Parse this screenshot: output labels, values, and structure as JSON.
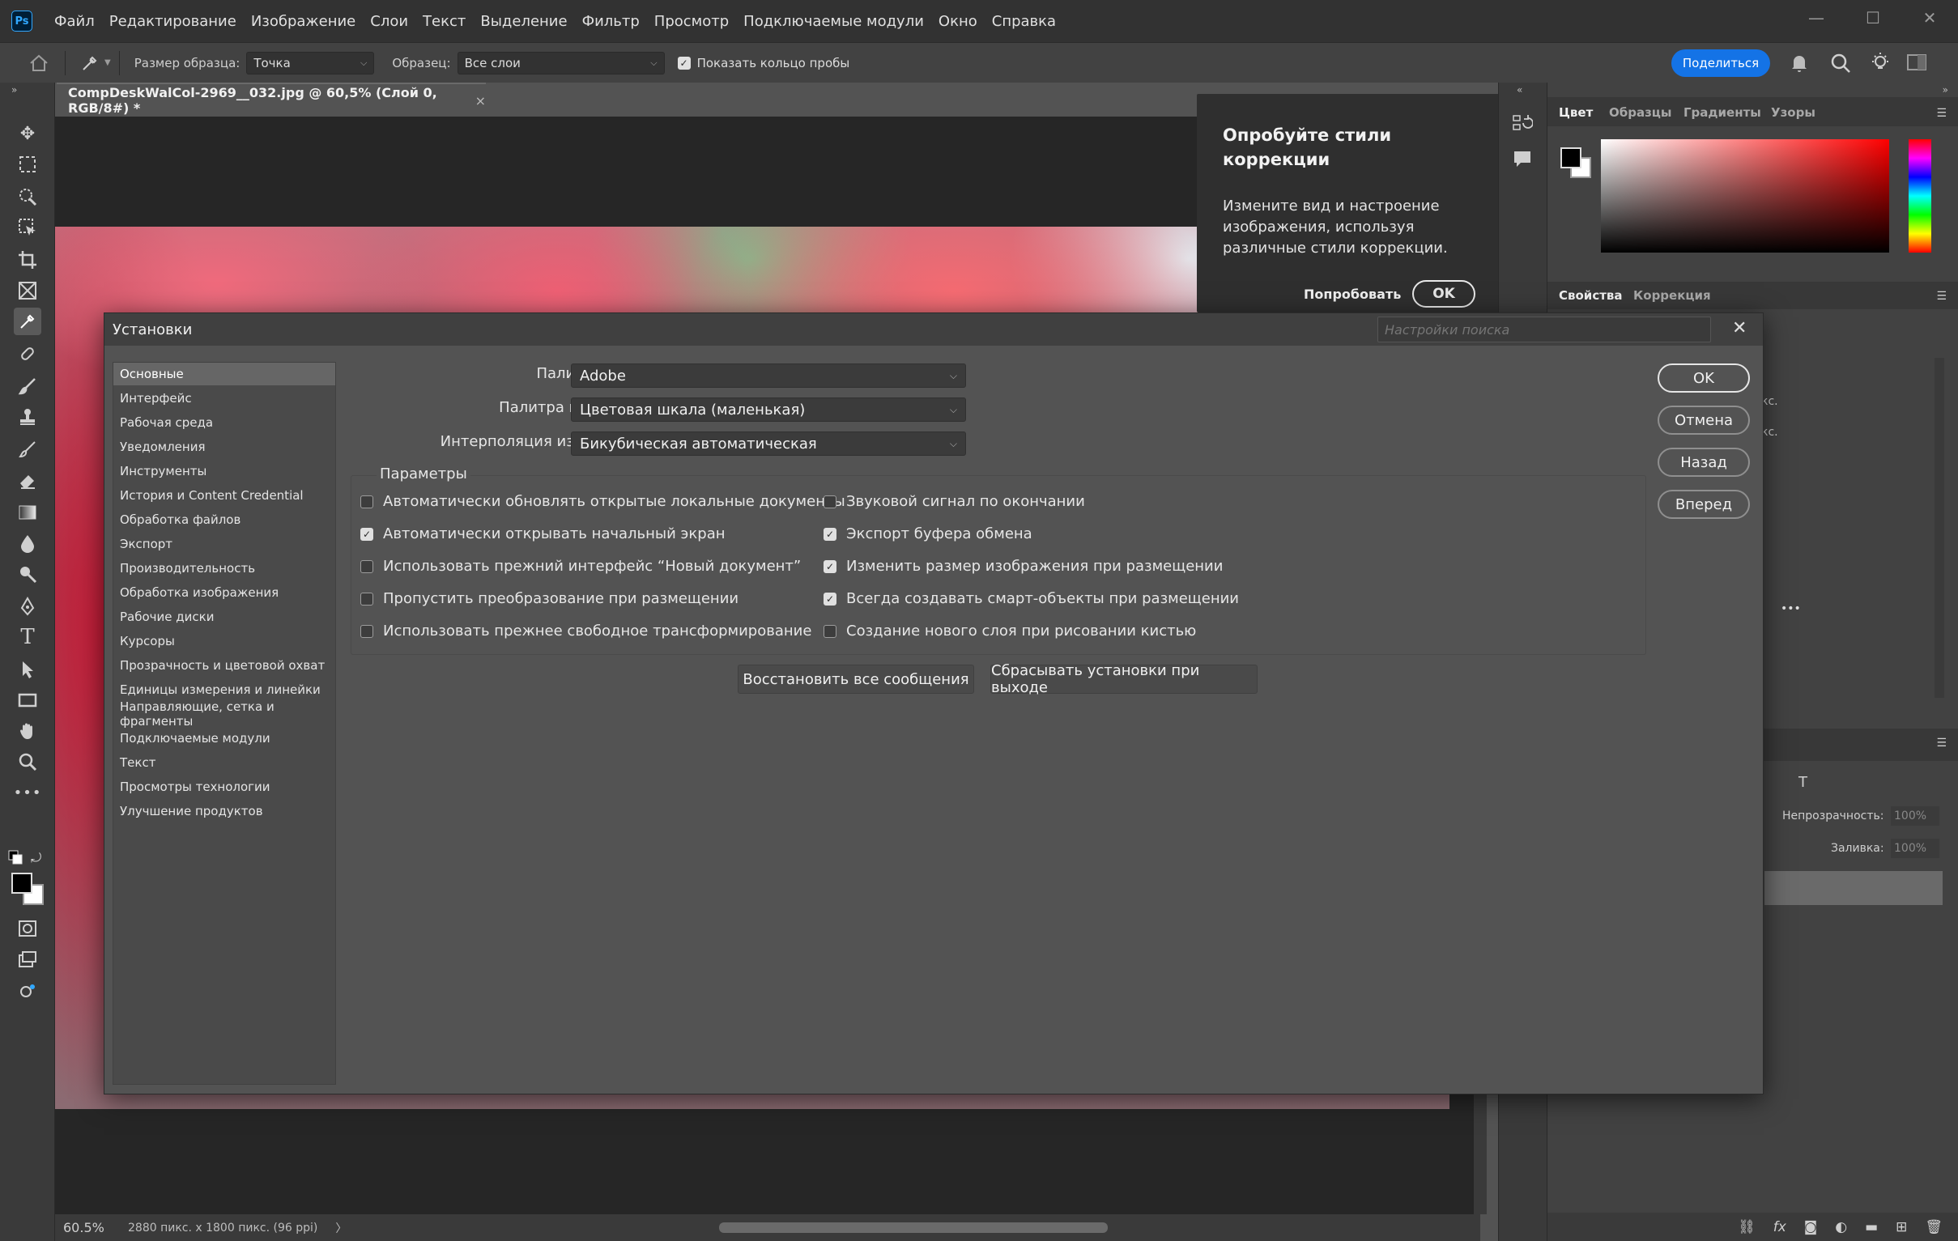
{
  "app": {
    "logo": "Ps"
  },
  "menu": [
    "Файл",
    "Редактирование",
    "Изображение",
    "Слои",
    "Текст",
    "Выделение",
    "Фильтр",
    "Просмотр",
    "Подключаемые модули",
    "Окно",
    "Справка"
  ],
  "window_controls": {
    "minimize": "—",
    "maximize": "☐",
    "close": "✕"
  },
  "options_bar": {
    "sample_size_label": "Размер образца:",
    "sample_size_value": "Точка",
    "sample_label": "Образец:",
    "sample_value": "Все слои",
    "show_ring_label": "Показать кольцо пробы",
    "show_ring_checked": true,
    "share_label": "Поделиться"
  },
  "document": {
    "tab_title": "CompDeskWalCol-2969__032.jpg @ 60,5% (Слой 0, RGB/8#) *",
    "tab_close": "×",
    "zoom": "60.5%",
    "size_info": "2880 пикс. x 1800 пикс. (96 ppi)",
    "status_arrow": "〉"
  },
  "tip": {
    "title": "Опробуйте стили коррекции",
    "body": "Измените вид и настроение изображения, используя различные стили коррекции.",
    "try_label": "Попробовать",
    "ok_label": "OK"
  },
  "color_panel": {
    "tabs": [
      "Цвет",
      "Образцы",
      "Градиенты",
      "Узоры"
    ],
    "active_tab": "Цвет",
    "hue_color": "#ff0000"
  },
  "props_panel": {
    "tabs": [
      "Свойства",
      "Коррекция"
    ],
    "active_tab": "Свойства",
    "px1": "кс.",
    "px2": "кс.",
    "more": "•••"
  },
  "layers_panel": {
    "opacity_label": "Непрозрачность:",
    "opacity_value": "100%",
    "fill_label": "Заливка:",
    "fill_value": "100%"
  },
  "dialog": {
    "title": "Установки",
    "search_placeholder": "Настройки поиска",
    "close": "✕",
    "nav": [
      "Основные",
      "Интерфейс",
      "Рабочая среда",
      "Уведомления",
      "Инструменты",
      "История и Content Credential",
      "Обработка файлов",
      "Экспорт",
      "Производительность",
      "Обработка изображения",
      "Рабочие диски",
      "Курсоры",
      "Прозрачность и цветовой охват",
      "Единицы измерения и линейки",
      "Направляющие, сетка и фрагменты",
      "Подключаемые модули",
      "Текст",
      "Просмотры технологии",
      "Улучшение продуктов"
    ],
    "selected_nav": "Основные",
    "fields": [
      {
        "label": "Палитра цветов:",
        "value": "Adobe"
      },
      {
        "label": "Палитра цветов HUD:",
        "value": "Цветовая шкала (маленькая)"
      },
      {
        "label": "Интерполяция изображения:",
        "value": "Бикубическая автоматическая"
      }
    ],
    "options_title": "Параметры",
    "options_left": [
      {
        "label": "Автоматически обновлять открытые локальные документы",
        "checked": false
      },
      {
        "label": "Автоматически открывать начальный экран",
        "checked": true
      },
      {
        "label": "Использовать прежний интерфейс “Новый документ”",
        "checked": false
      },
      {
        "label": "Пропустить преобразование при размещении",
        "checked": false
      },
      {
        "label": "Использовать прежнее свободное трансформирование",
        "checked": false
      }
    ],
    "options_right": [
      {
        "label": "Звуковой сигнал по окончании",
        "checked": false
      },
      {
        "label": "Экспорт буфера обмена",
        "checked": true
      },
      {
        "label": "Изменить размер изображения при размещении",
        "checked": true
      },
      {
        "label": "Всегда создавать смарт-объекты при размещении",
        "checked": true
      },
      {
        "label": "Создание нового слоя при рисовании кистью",
        "checked": false
      }
    ],
    "restore_label": "Восстановить все сообщения",
    "reset_label": "Сбрасывать установки при выходе",
    "buttons": {
      "ok": "OK",
      "cancel": "Отмена",
      "back": "Назад",
      "forward": "Вперед"
    }
  }
}
